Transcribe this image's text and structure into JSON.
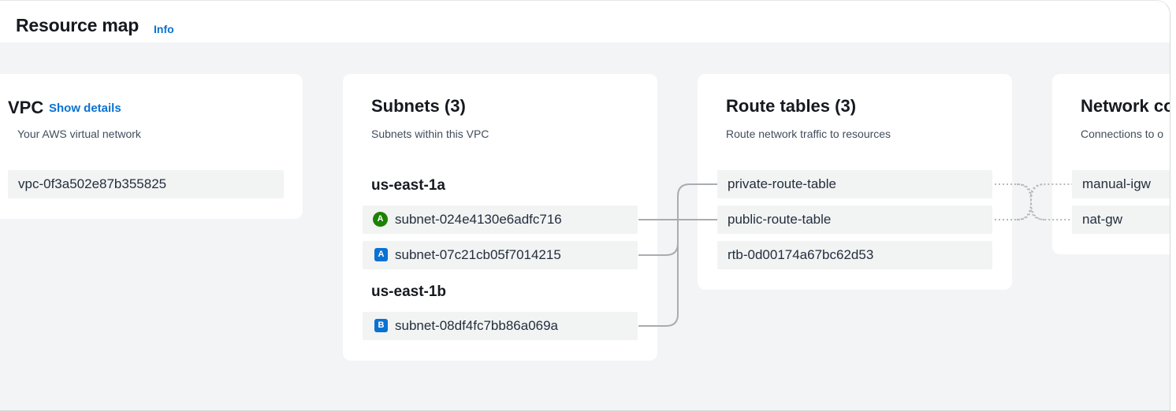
{
  "header": {
    "title": "Resource map",
    "info_label": "Info"
  },
  "vpc": {
    "title": "VPC",
    "show_details_label": "Show details",
    "subtitle": "Your AWS virtual network",
    "id": "vpc-0f3a502e87b355825"
  },
  "subnets": {
    "title": "Subnets (3)",
    "subtitle": "Subnets within this VPC",
    "zones": [
      {
        "name": "us-east-1a",
        "items": [
          {
            "badge": "A",
            "badge_style": "circle",
            "badge_color": "#1d8102",
            "id": "subnet-024e4130e6adfc716"
          },
          {
            "badge": "A",
            "badge_style": "square",
            "badge_color": "#0972d3",
            "id": "subnet-07c21cb05f7014215"
          }
        ]
      },
      {
        "name": "us-east-1b",
        "items": [
          {
            "badge": "B",
            "badge_style": "square",
            "badge_color": "#0972d3",
            "id": "subnet-08df4fc7bb86a069a"
          }
        ]
      }
    ]
  },
  "route_tables": {
    "title": "Route tables (3)",
    "subtitle": "Route network traffic to resources",
    "items": [
      "private-route-table",
      "public-route-table",
      "rtb-0d00174a67bc62d53"
    ]
  },
  "network_connections": {
    "title": "Network co",
    "subtitle": "Connections to o",
    "items": [
      "manual-igw",
      "nat-gw"
    ]
  },
  "colors": {
    "link": "#0972d3",
    "canvas_bg": "#f3f4f6",
    "item_bg": "#f2f3f3",
    "connector": "#a9acb0",
    "connector_dotted": "#b5b8bc"
  }
}
